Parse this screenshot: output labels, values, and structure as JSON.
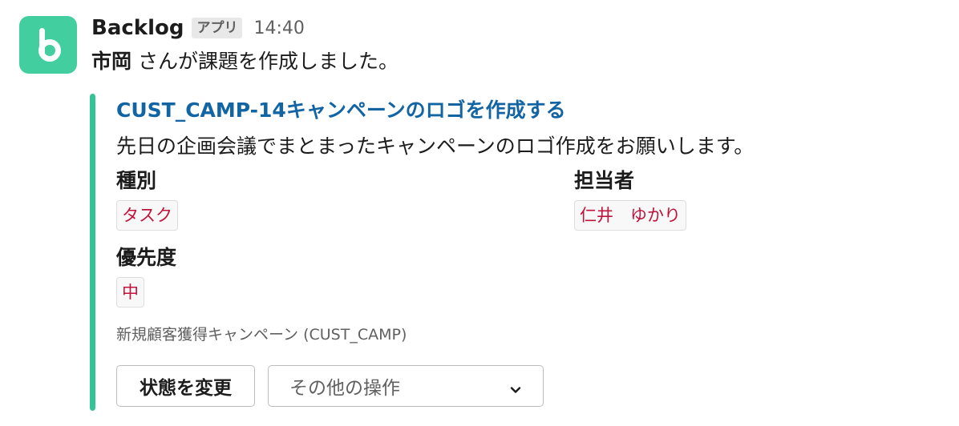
{
  "header": {
    "app_name": "Backlog",
    "app_badge": "アプリ",
    "timestamp": "14:40"
  },
  "message": {
    "user": "市岡",
    "text": " さんが課題を作成しました。"
  },
  "issue": {
    "title": "CUST_CAMP-14キャンペーンのロゴを作成する",
    "description": "先日の企画会議でまとまったキャンペーンのロゴ作成をお願いします。",
    "fields": {
      "type_label": "種別",
      "type_value": "タスク",
      "assignee_label": "担当者",
      "assignee_value": "仁井　ゆかり",
      "priority_label": "優先度",
      "priority_value": "中"
    },
    "project": "新規顧客獲得キャンペーン (CUST_CAMP)"
  },
  "actions": {
    "change_status": "状態を変更",
    "other_actions": "その他の操作"
  },
  "colors": {
    "brand": "#42ce9f",
    "accent_bar": "#33c394",
    "link": "#1264a3",
    "tag_text": "#c0143c"
  },
  "icons": {
    "avatar": "backlog-logo-icon",
    "dropdown": "chevron-down-icon"
  }
}
